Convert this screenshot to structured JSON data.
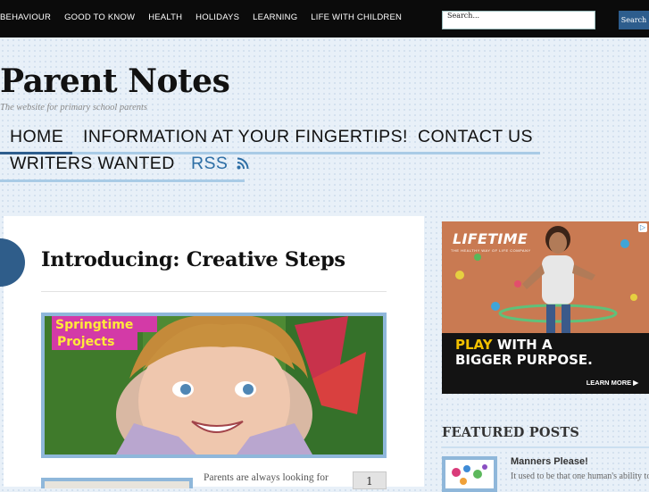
{
  "top_nav": [
    "BEHAVIOUR",
    "GOOD TO KNOW",
    "HEALTH",
    "HOLIDAYS",
    "LEARNING",
    "LIFE WITH CHILDREN"
  ],
  "search": {
    "placeholder": "Search...",
    "button": "Search"
  },
  "site": {
    "title": "Parent Notes",
    "tagline": "The website for primary school parents"
  },
  "main_nav": {
    "home": "HOME",
    "info": "INFORMATION AT YOUR FINGERTIPS!",
    "contact": "CONTACT US",
    "writers": "WRITERS WANTED",
    "rss": "RSS"
  },
  "post": {
    "title": "Introducing: Creative Steps",
    "hero_caption_line1": "Springtime",
    "hero_caption_line2": "Projects",
    "excerpt": "Parents are always looking for",
    "comment_count": "1"
  },
  "ad": {
    "brand": "LIFETIME",
    "brand_sub": "THE HEALTHY WAY OF LIFE COMPANY",
    "headline_hl": "PLAY",
    "headline_rest": " WITH A",
    "headline_line2": "BIGGER PURPOSE.",
    "cta": "LEARN MORE ▶",
    "corner": "▷"
  },
  "featured": {
    "heading": "FEATURED POSTS",
    "items": [
      {
        "title": "Manners Please!",
        "excerpt": "It used to be that one human's ability to"
      }
    ]
  },
  "colors": {
    "accent": "#2d5d8d",
    "accent_link": "#2d6ea5",
    "nav_underline": "#a9cbe6",
    "image_border": "#8fb7da",
    "topbar": "#0b0b0b"
  },
  "icons": {
    "rss": "rss-feed-icon"
  }
}
